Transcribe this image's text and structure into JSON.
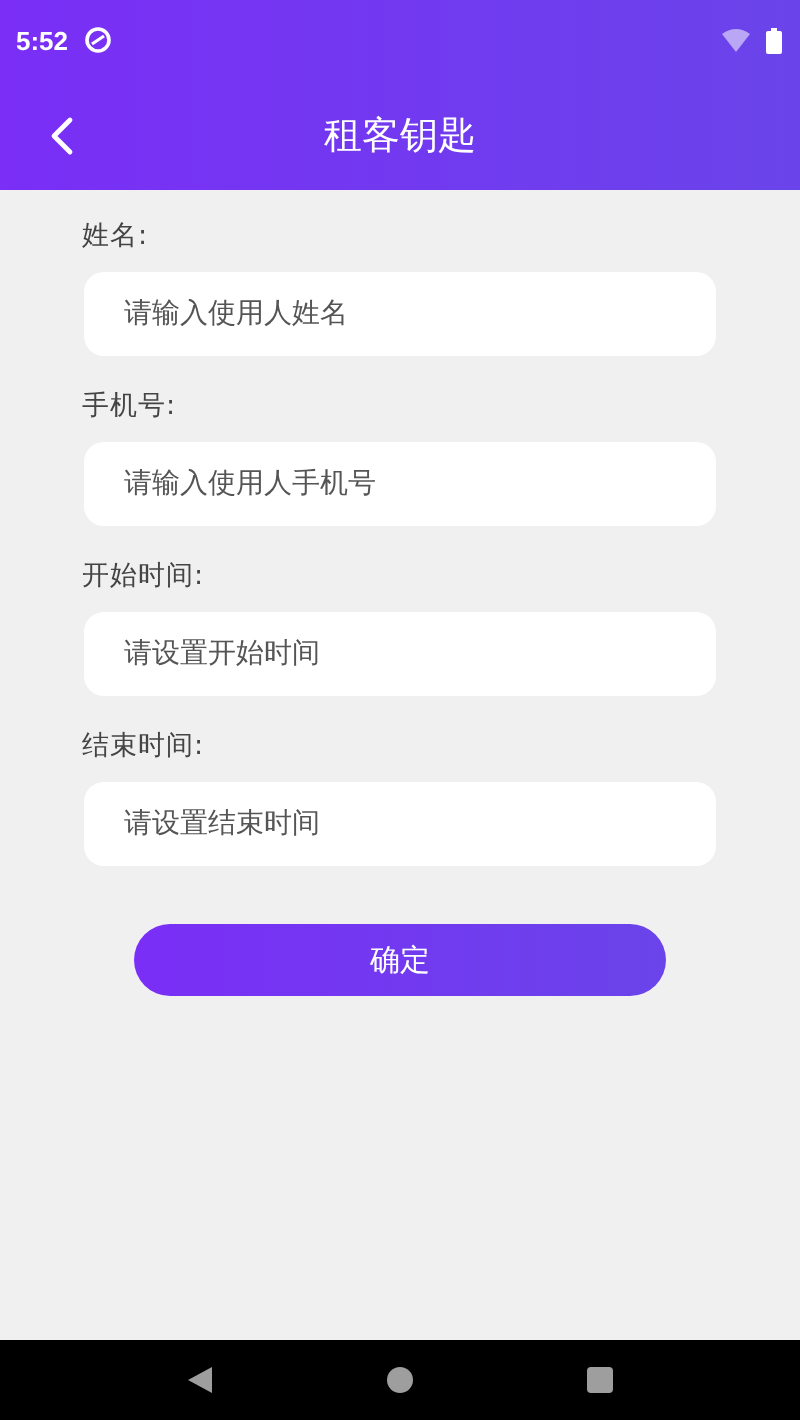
{
  "status_bar": {
    "time": "5:52"
  },
  "header": {
    "title": "租客钥匙"
  },
  "fields": [
    {
      "label": "姓名:",
      "placeholder": "请输入使用人姓名"
    },
    {
      "label": "手机号:",
      "placeholder": "请输入使用人手机号"
    },
    {
      "label": "开始时间:",
      "placeholder": "请设置开始时间"
    },
    {
      "label": "结束时间:",
      "placeholder": "请设置结束时间"
    }
  ],
  "confirm_button": "确定"
}
